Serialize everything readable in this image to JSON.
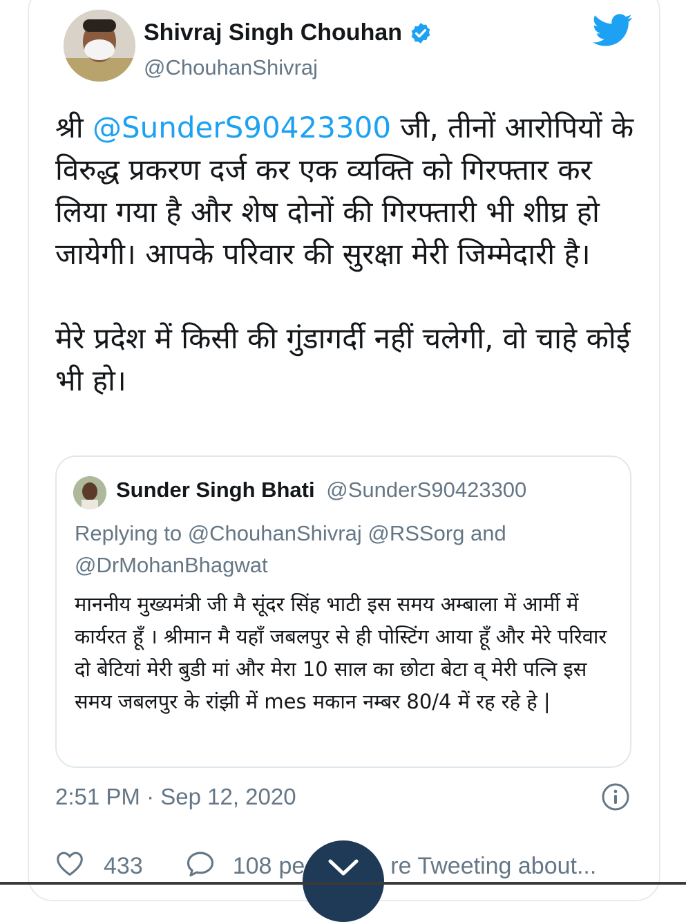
{
  "tweet": {
    "author_name": "Shivraj Singh Chouhan",
    "author_handle": "@ChouhanShivraj",
    "text_prefix": "श्री ",
    "mention": "@SunderS90423300",
    "text_rest": " जी,  तीनों आरोपियों के विरुद्ध प्रकरण दर्ज कर एक व्यक्ति को गिरफ्तार कर लिया गया है और शेष दोनों की गिरफ्तारी भी शीघ्र हो जायेगी। आपके परिवार की सुरक्षा मेरी जिम्मेदारी है।",
    "text_para2": "मेरे प्रदेश में किसी की गुंडागर्दी नहीं चलेगी, वो चाहे कोई भी हो।",
    "timestamp": "2:51 PM · Sep 12, 2020"
  },
  "quote": {
    "author_name": "Sunder Singh Bhati",
    "author_handle": "@SunderS90423300",
    "replying_to": "Replying to @ChouhanShivraj @RSSorg and @DrMohanBhagwat",
    "text": "माननीय मुख्यमंत्री जी मै सूंदर सिंह भाटी इस समय अम्बाला में आर्मी में कार्यरत हूँ ।  श्रीमान मै यहाँ जबलपुर से ही पोस्टिंग आया हूँ और मेरे परिवार दो बेटियां मेरी बुडी मां और मेरा 10 साल का छोटा बेटा व् मेरी पत्नि इस समय जबलपुर के रांझी में mes मकान नम्बर 80/4 में रह रहे हे |"
  },
  "actions": {
    "likes": "433",
    "replies": "108",
    "replies_suffix": "pe",
    "tweeting_about": "re Tweeting about..."
  },
  "colors": {
    "accent": "#1da1f2",
    "secondary_text": "#657786",
    "fab": "#1f3a56"
  },
  "icons": [
    "twitter-bird-icon",
    "verified-badge-icon",
    "info-icon",
    "heart-icon",
    "reply-icon",
    "chevron-down-icon"
  ]
}
